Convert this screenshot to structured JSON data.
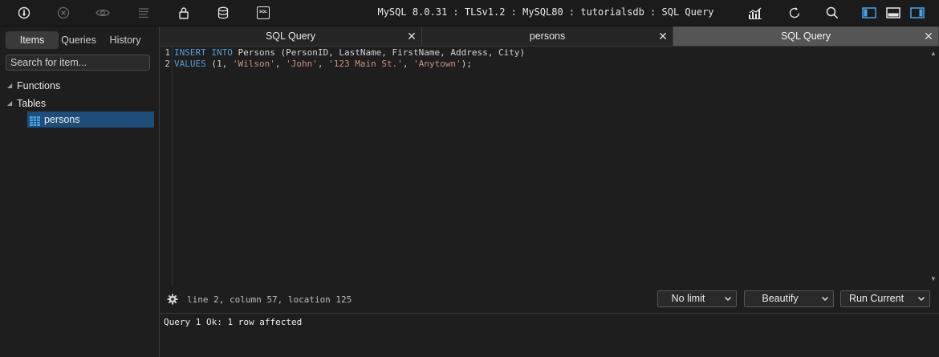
{
  "toolbar": {
    "icons": [
      "connect-icon",
      "disconnect-icon",
      "eye-icon",
      "list-icon",
      "lock-icon",
      "database-icon",
      "sql-icon",
      "chart-icon",
      "refresh-icon",
      "search-icon",
      "panel-left-icon",
      "panel-bottom-icon",
      "panel-right-icon"
    ],
    "sql_badge": "SQL",
    "title": "MySQL 8.0.31 : TLSv1.2 : MySQL80 : tutorialsdb : SQL Query"
  },
  "sidebar": {
    "tabs": [
      {
        "label": "Items",
        "active": true
      },
      {
        "label": "Queries",
        "active": false
      },
      {
        "label": "History",
        "active": false
      }
    ],
    "search_placeholder": "Search for item...",
    "tree": {
      "functions": "Functions",
      "tables": "Tables",
      "persons": "persons"
    }
  },
  "tabs": [
    {
      "label": "SQL Query",
      "active": false
    },
    {
      "label": "persons",
      "active": false
    },
    {
      "label": "SQL Query",
      "active": true
    }
  ],
  "editor": {
    "line_numbers": [
      "1",
      "2"
    ],
    "line1": {
      "insert": "INSERT",
      "into": "INTO",
      "rest": " Persons (PersonID, LastName, FirstName, Address, City)"
    },
    "line2": {
      "values": "VALUES",
      "open": " (",
      "n1": "1",
      "sep1": ", ",
      "s1": "'Wilson'",
      "sep2": ", ",
      "s2": "'John'",
      "sep3": ", ",
      "s3": "'123 Main St.'",
      "sep4": ", ",
      "s4": "'Anytown'",
      "close": ");"
    }
  },
  "status": {
    "position": "line 2, column 57, location 125",
    "limit_label": "No limit",
    "beautify_label": "Beautify",
    "run_label": "Run Current"
  },
  "result": {
    "message": "Query 1 Ok: 1 row affected"
  },
  "colors": {
    "accent": "#1f4d79",
    "panel_icon": "#4aa3e8",
    "keyword": "#569cd6",
    "string": "#ce9178",
    "number": "#b5cea8"
  }
}
